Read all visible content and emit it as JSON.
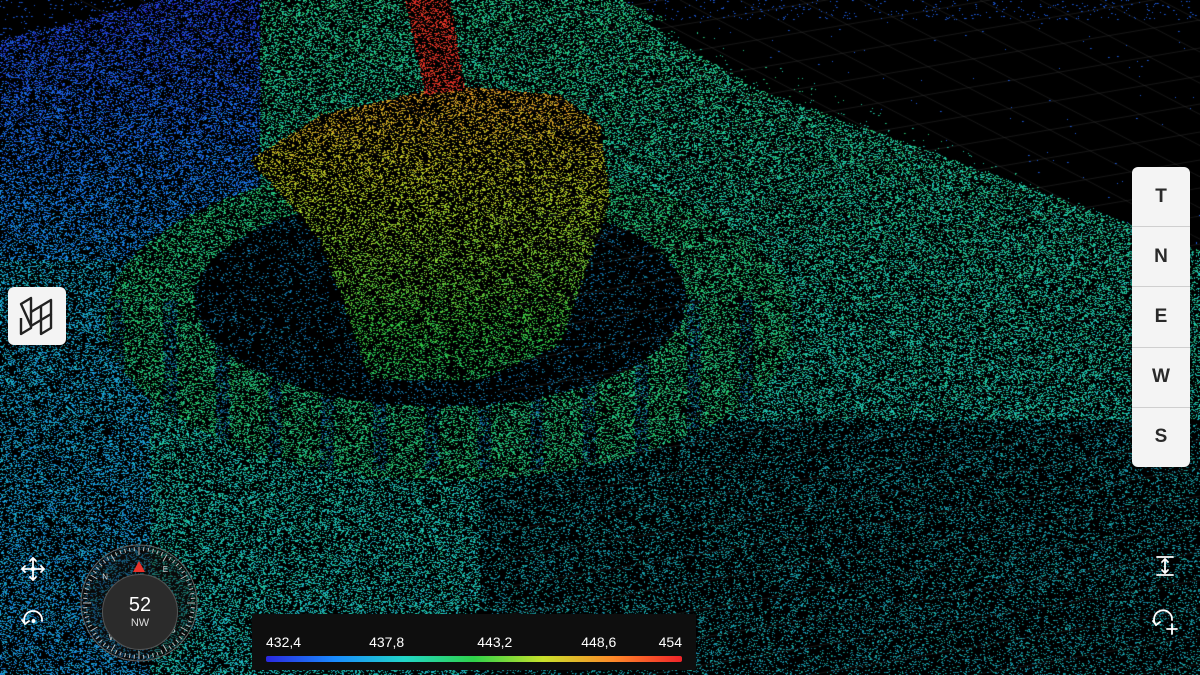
{
  "view_panel": {
    "buttons": [
      {
        "label": "T",
        "name": "view-top-button"
      },
      {
        "label": "N",
        "name": "view-north-button"
      },
      {
        "label": "E",
        "name": "view-east-button"
      },
      {
        "label": "W",
        "name": "view-west-button"
      },
      {
        "label": "S",
        "name": "view-south-button"
      }
    ]
  },
  "compass": {
    "heading": "52",
    "direction": "NW",
    "ring_letters": [
      "N",
      "E",
      "S",
      "W"
    ]
  },
  "colorbar": {
    "labels": [
      "432,4",
      "437,8",
      "443,2",
      "448,6",
      "454"
    ],
    "colors": [
      "#2a28e0",
      "#1a8cff",
      "#22d6c8",
      "#2fd24a",
      "#c9e12b",
      "#ff8a2a",
      "#f0242a"
    ]
  },
  "icons": {
    "logo": "stacked-layers-icon",
    "pan": "move-arrows-icon",
    "rotate_left": "rotate-left-icon",
    "measure": "height-measure-icon",
    "rotate_right": "rotate-add-icon"
  },
  "colors": {
    "panel_bg": "#f4f4f4",
    "scene_bg": "#000000"
  }
}
